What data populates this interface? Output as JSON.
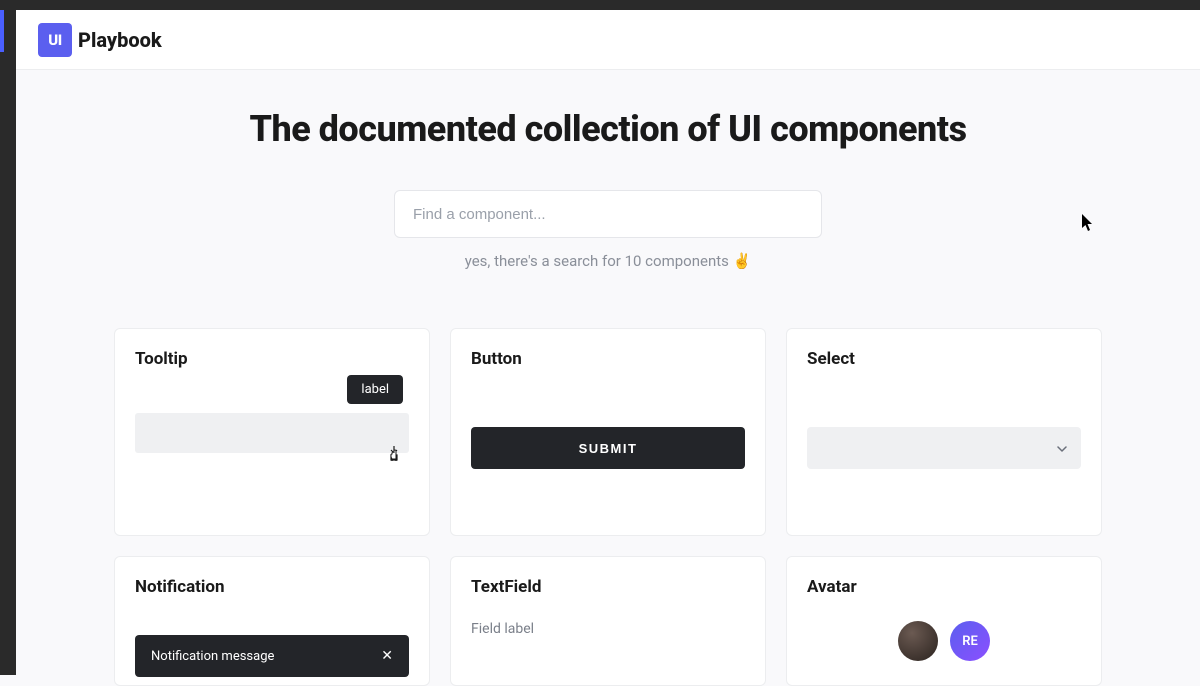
{
  "logo": {
    "badge": "UI",
    "text": "Playbook"
  },
  "hero": {
    "title": "The documented collection of UI components"
  },
  "search": {
    "placeholder": "Find a component...",
    "hint": "yes, there's a search for 10 components ✌️"
  },
  "cards": {
    "tooltip": {
      "title": "Tooltip",
      "label": "label"
    },
    "button": {
      "title": "Button",
      "submit": "SUBMIT"
    },
    "select": {
      "title": "Select"
    },
    "notification": {
      "title": "Notification",
      "message": "Notification message"
    },
    "textfield": {
      "title": "TextField",
      "label": "Field label"
    },
    "avatar": {
      "title": "Avatar",
      "initials": "RE"
    }
  }
}
